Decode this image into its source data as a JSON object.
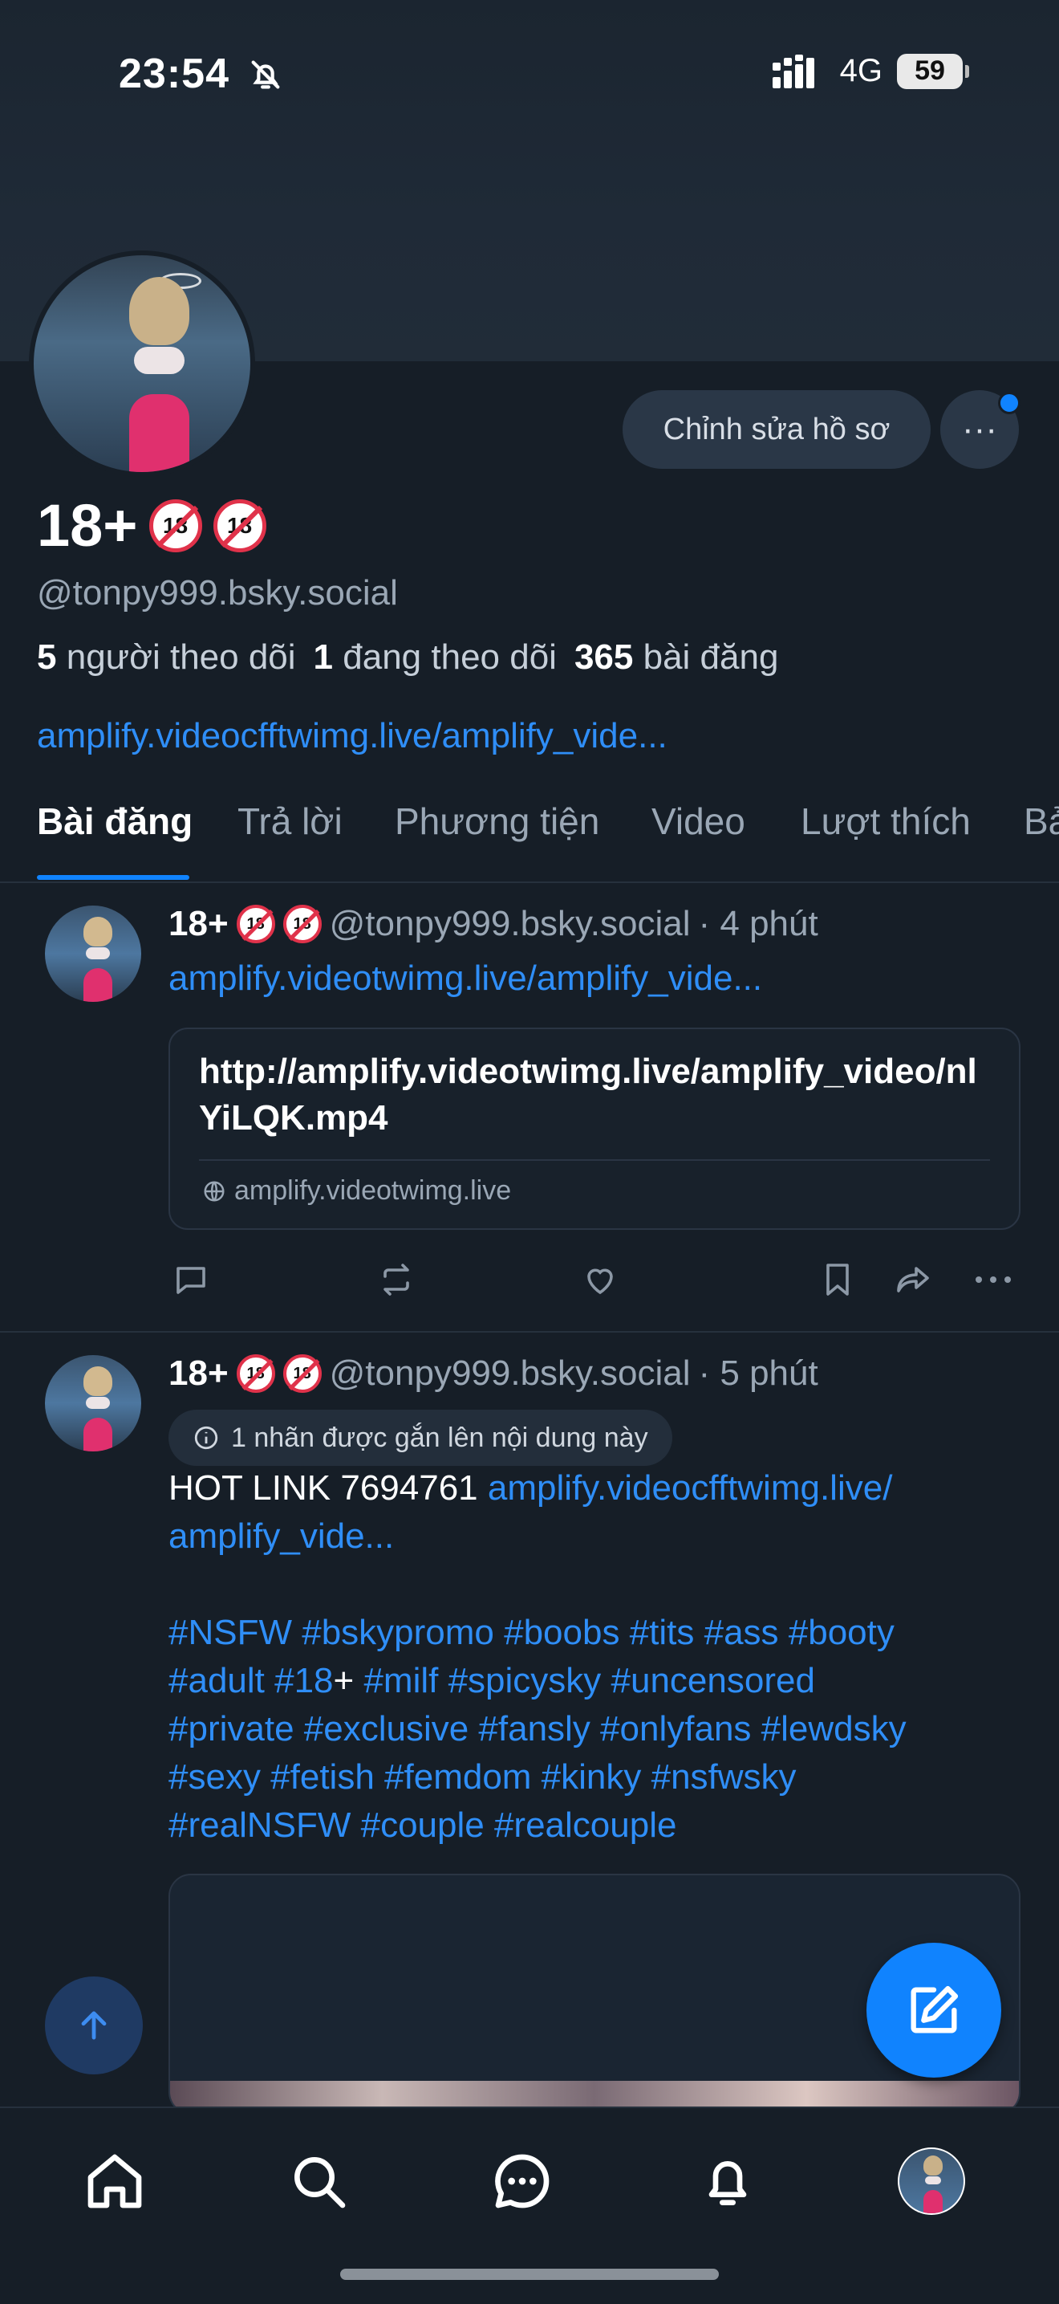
{
  "status_bar": {
    "time": "23:54",
    "network": "4G",
    "battery": "59"
  },
  "profile": {
    "display_name": "18+",
    "emoji_text": "18",
    "handle": "@tonpy999.bsky.social",
    "followers_count": "5",
    "followers_label": "người theo dõi",
    "following_count": "1",
    "following_label": "đang theo dõi",
    "posts_count": "365",
    "posts_label": "bài đăng",
    "link": "amplify.videocfftwimg.live/amplify_vide...",
    "edit_button": "Chỉnh sửa hồ sơ",
    "more_button": "···"
  },
  "tabs": [
    "Bài đăng",
    "Trả lời",
    "Phương tiện",
    "Video",
    "Lượt thích",
    "Bả"
  ],
  "posts": [
    {
      "author": "18+",
      "handle": "@tonpy999.bsky.social",
      "time": "· 4 phút",
      "link_text": "amplify.videotwimg.live/amplify_vide...",
      "card_title": "http://amplify.videotwimg.live/amplify_video/nlYiLQK.mp4",
      "card_domain": "amplify.videotwimg.live"
    },
    {
      "author": "18+",
      "handle": "@tonpy999.bsky.social",
      "time": "· 5 phút",
      "label_notice": "1 nhãn được gắn lên nội dung này",
      "text_prefix": "HOT LINK 7694761",
      "link_part1": "amplify.videocfftwimg.live/",
      "link_part2": "amplify_vide...",
      "hashtags_line1": "#NSFW #bskypromo #boobs #tits #ass #booty",
      "hashtags_line2_a": "#adult #18",
      "hashtags_line2_b": "+",
      "hashtags_line2_c": " #milf #spicysky #uncensored",
      "hashtags_line3": "#private #exclusive #fansly #onlyfans #lewdsky",
      "hashtags_line4": "#sexy #fetish #femdom #kinky #nsfwsky",
      "hashtags_line5": "#realNSFW #couple #realcouple"
    }
  ],
  "colors": {
    "background": "#161e27",
    "accent": "#1083fe",
    "link": "#2f8ef7",
    "muted": "#9aa7b5"
  },
  "icons": {
    "nav": [
      "home-icon",
      "search-icon",
      "chat-icon",
      "bell-icon",
      "profile-avatar"
    ],
    "post_actions": [
      "reply-icon",
      "repost-icon",
      "like-icon",
      "bookmark-icon",
      "share-icon",
      "more-icon"
    ]
  }
}
